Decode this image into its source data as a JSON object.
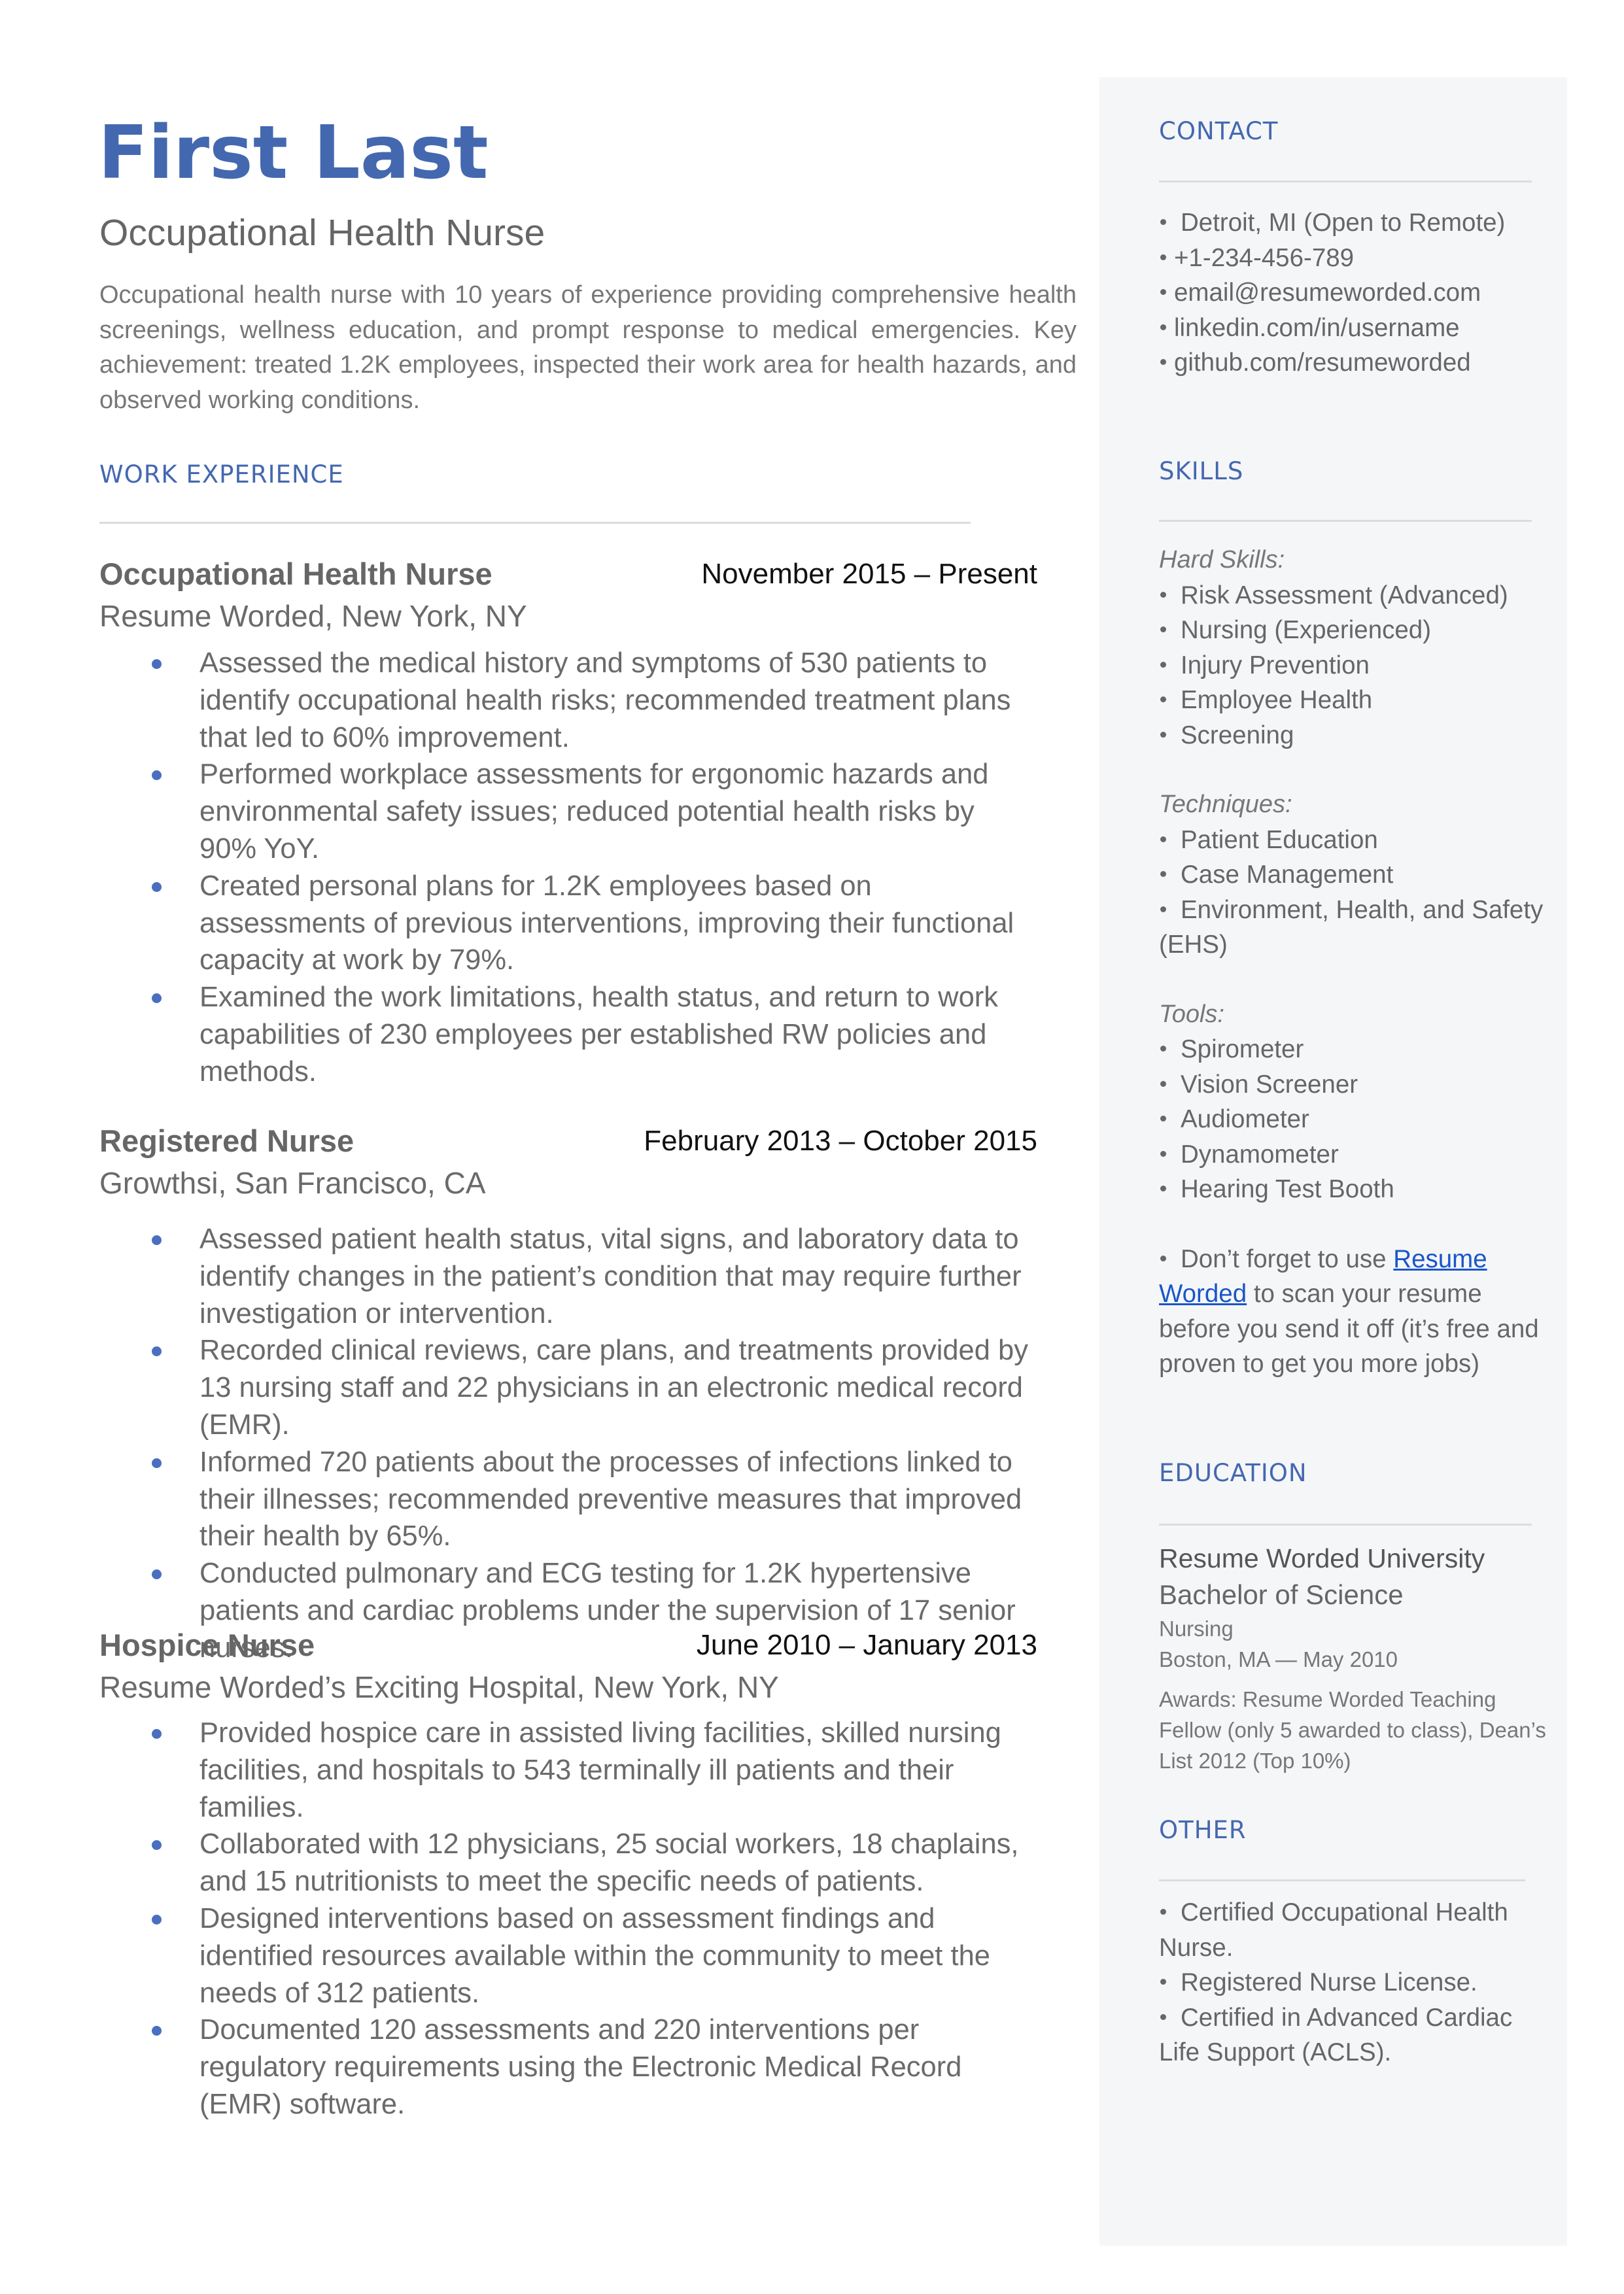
{
  "header": {
    "name": "First Last",
    "role": "Occupational Health Nurse",
    "summary": "Occupational health nurse with 10 years of experience providing comprehensive health screenings, wellness education, and prompt response to medical emergencies. Key achievement: treated 1.2K employees, inspected their work area for health hazards, and observed working conditions."
  },
  "colors": {
    "accent": "#4468B0",
    "bullet": "#4A6FC0",
    "sidebar_bg": "#F5F6F8",
    "link": "#1A56C9"
  },
  "work": {
    "title": "WORK EXPERIENCE",
    "jobs": [
      {
        "title": "Occupational Health Nurse",
        "dates": "November 2015 – Present",
        "company": "Resume Worded, New York, NY",
        "bullets": [
          "Assessed the medical history and symptoms of 530 patients to identify occupational health risks; recommended treatment plans that led to 60% improvement.",
          "Performed workplace assessments for ergonomic hazards and environmental safety issues; reduced potential health risks by 90% YoY.",
          "Created personal plans for 1.2K employees based on assessments of previous interventions, improving their functional capacity at work by 79%.",
          "Examined the work limitations, health status, and return to work capabilities of 230 employees per established RW policies and methods."
        ]
      },
      {
        "title": "Registered Nurse",
        "dates": "February 2013 – October 2015",
        "company": "Growthsi, San Francisco, CA",
        "bullets": [
          "Assessed patient health status, vital signs, and laboratory data to identify changes in the patient’s condition that may require further investigation or intervention.",
          "Recorded clinical reviews, care plans, and treatments provided by 13 nursing staff and 22 physicians in an electronic medical record (EMR).",
          "Informed 720 patients about the processes of infections linked to their illnesses; recommended preventive measures that improved their health by 65%.",
          "Conducted pulmonary and ECG testing for 1.2K hypertensive patients and cardiac problems under the supervision of 17 senior nurses."
        ]
      },
      {
        "title": "Hospice Nurse",
        "dates": "June 2010 – January 2013",
        "company": "Resume Worded’s Exciting Hospital, New York, NY",
        "bullets": [
          "Provided hospice care in assisted living facilities, skilled nursing facilities, and hospitals to 543 terminally ill patients and their families.",
          "Collaborated with 12 physicians, 25 social workers, 18 chaplains, and 15 nutritionists to meet the specific needs of patients.",
          "Designed interventions based on assessment findings and identified resources available within the community to meet the needs of 312 patients.",
          "Documented 120 assessments and 220 interventions per regulatory requirements using the Electronic Medical Record (EMR) software."
        ]
      }
    ]
  },
  "sidebar": {
    "contact": {
      "title": "CONTACT",
      "items": [
        "Detroit, MI (Open to Remote)",
        "+1-234-456-789",
        "email@resumeworded.com",
        "linkedin.com/in/username",
        "github.com/resumeworded"
      ]
    },
    "skills": {
      "title": "SKILLS",
      "groups": [
        {
          "label": "Hard Skills:",
          "items": [
            "Risk Assessment (Advanced)",
            "Nursing (Experienced)",
            "Injury Prevention",
            "Employee Health",
            "Screening"
          ]
        },
        {
          "label": "Techniques:",
          "items": [
            "Patient Education",
            "Case Management",
            "Environment, Health, and Safety (EHS)"
          ]
        },
        {
          "label": "Tools:",
          "items": [
            "Spirometer",
            "Vision Screener",
            "Audiometer",
            "Dynamometer",
            "Hearing Test Booth"
          ]
        }
      ],
      "tip": {
        "before": "Don’t forget to use ",
        "link": "Resume Worded",
        "after": " to scan your resume before you send it off (it’s free and proven to get you more jobs)"
      }
    },
    "education": {
      "title": "EDUCATION",
      "school": "Resume Worded University",
      "degree": "Bachelor of Science",
      "field": "Nursing",
      "location_date": "Boston, MA — May 2010",
      "awards": "Awards: Resume Worded Teaching Fellow (only 5 awarded to class), Dean’s List 2012 (Top 10%)"
    },
    "other": {
      "title": "OTHER",
      "items": [
        "Certified Occupational Health Nurse.",
        "Registered Nurse License.",
        "Certified in Advanced Cardiac Life Support (ACLS)."
      ]
    }
  }
}
